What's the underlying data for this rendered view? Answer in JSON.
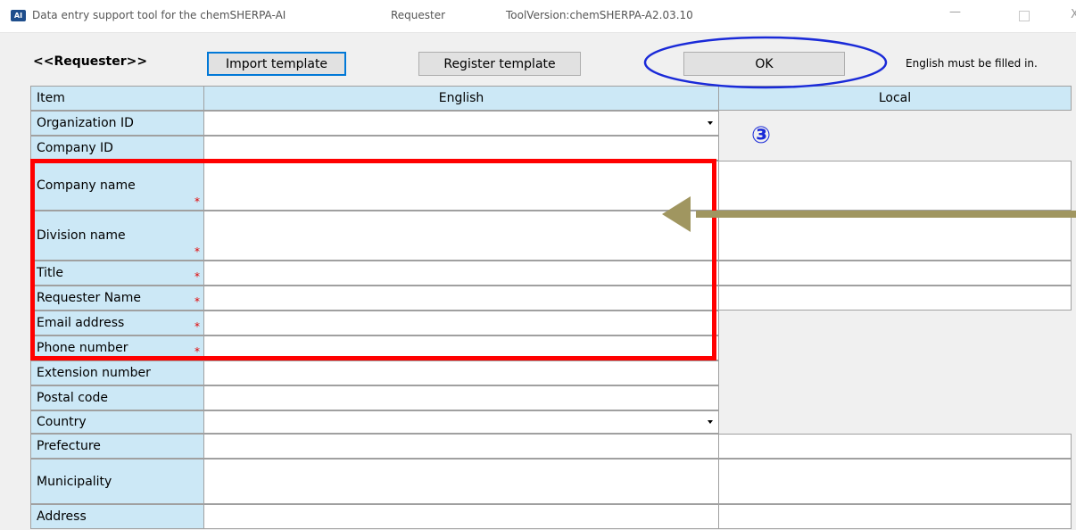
{
  "window": {
    "app_icon": "AI",
    "title": "Data entry support tool for the chemSHERPA-AI",
    "mode": "Requester",
    "version": "ToolVersion:chemSHERPA-A2.03.10",
    "minimize": "—",
    "maximize": "",
    "close": "X"
  },
  "header": {
    "section_label": "<<Requester>>",
    "import_label": "Import template",
    "register_label": "Register template",
    "ok_label": "OK",
    "note": "English must be filled in."
  },
  "table": {
    "col_item": "Item",
    "col_english": "English",
    "col_local": "Local",
    "rows": [
      {
        "label": "Organization ID",
        "required": false,
        "dropdown": true
      },
      {
        "label": "Company ID",
        "required": false
      },
      {
        "label": "Company name",
        "required": true
      },
      {
        "label": "Division name",
        "required": true
      },
      {
        "label": "Title",
        "required": true
      },
      {
        "label": "Requester Name",
        "required": true
      },
      {
        "label": "Email address",
        "required": true
      },
      {
        "label": "Phone number",
        "required": true
      },
      {
        "label": "Extension number",
        "required": false
      },
      {
        "label": "Postal code",
        "required": false
      },
      {
        "label": "Country",
        "required": false,
        "dropdown": true
      },
      {
        "label": "Prefecture",
        "required": false
      },
      {
        "label": "Municipality",
        "required": false
      },
      {
        "label": "Address",
        "required": false
      }
    ],
    "required_mark": "*"
  },
  "annotations": {
    "step_marker": "③",
    "highlight_color": "#ff0000",
    "ellipse_color": "#1a2ad8",
    "arrow_color": "#a09660"
  }
}
